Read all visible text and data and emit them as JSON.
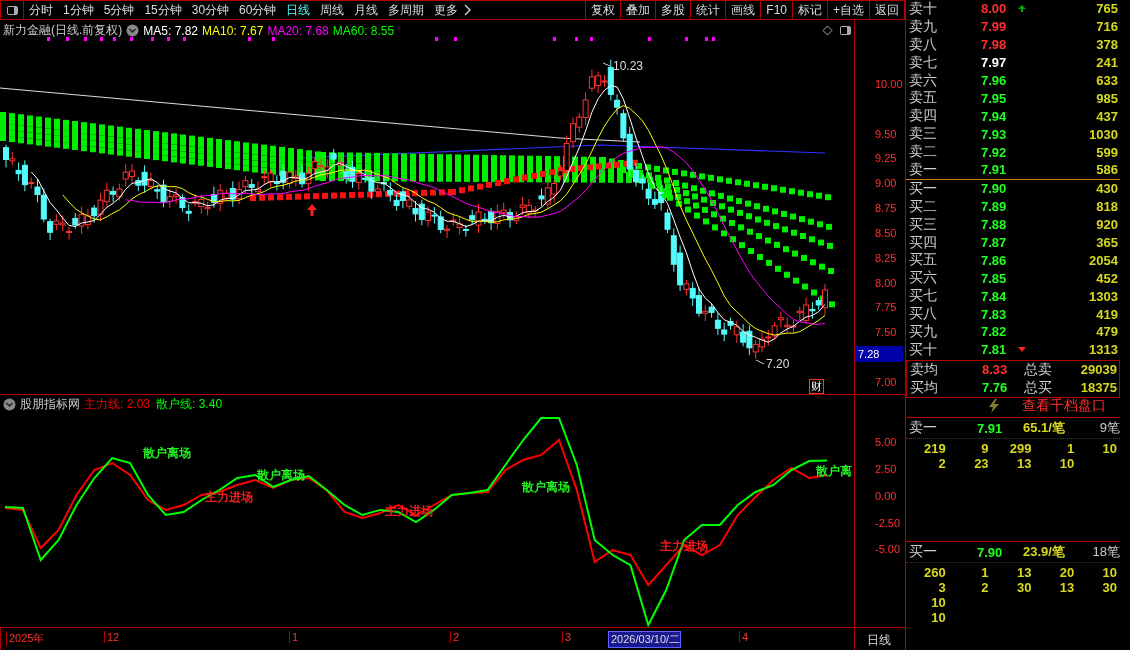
{
  "toolbar": {
    "periods": [
      {
        "label": "分时",
        "selected": false
      },
      {
        "label": "1分钟",
        "selected": false
      },
      {
        "label": "5分钟",
        "selected": false
      },
      {
        "label": "15分钟",
        "selected": false
      },
      {
        "label": "30分钟",
        "selected": false
      },
      {
        "label": "60分钟",
        "selected": false
      },
      {
        "label": "日线",
        "selected": true
      },
      {
        "label": "周线",
        "selected": false
      },
      {
        "label": "月线",
        "selected": false
      },
      {
        "label": "多周期",
        "selected": false
      },
      {
        "label": "更多",
        "selected": false
      }
    ],
    "actions": [
      "复权",
      "叠加",
      "多股",
      "统计",
      "画线",
      "F10",
      "标记",
      "+自选",
      "返回"
    ]
  },
  "main_chart": {
    "title": "新力金融(日线.前复权)",
    "ma": [
      {
        "label": "MA5: 7.82",
        "color": "#ffffff"
      },
      {
        "label": "MA10: 7.67",
        "color": "#ffff00"
      },
      {
        "label": "MA20: 7.68",
        "color": "#ff00ff"
      },
      {
        "label": "MA60: 8.55",
        "color": "#00ff00"
      }
    ],
    "yticks": [
      "10.00",
      "9.50",
      "9.25",
      "9.00",
      "8.75",
      "8.50",
      "8.25",
      "8.00",
      "7.75",
      "7.50",
      "7.00"
    ],
    "high_label": "10.23",
    "low_label": "7.20",
    "current_price": "7.28",
    "badge": "财"
  },
  "indicator": {
    "title": "股朋指标网",
    "lines": [
      {
        "name": "主力线",
        "value": ": 2.03",
        "color": "#ff0000"
      },
      {
        "name": "散户线",
        "value": ": 3.40",
        "color": "#00ff00"
      }
    ],
    "yticks": [
      "5.00",
      "2.50",
      "0.00",
      "-2.50",
      "-5.00"
    ],
    "signals": [
      {
        "text": "散户离场",
        "color": "#20ff20"
      },
      {
        "text": "主力进场",
        "color": "#ff2020"
      },
      {
        "text": "散户离场",
        "color": "#20ff20"
      },
      {
        "text": "主力进场",
        "color": "#ff2020"
      },
      {
        "text": "散户离场",
        "color": "#20ff20"
      },
      {
        "text": "主力进场",
        "color": "#ff2020"
      },
      {
        "text": "散户离",
        "color": "#20ff20"
      }
    ],
    "kind": "picture"
  },
  "order_book": {
    "rows": [
      {
        "label": "卖十",
        "price": "8.00",
        "volume": "765",
        "color": "#ff3030",
        "kind": "rising"
      },
      {
        "label": "卖九",
        "price": "7.99",
        "volume": "716",
        "color": "#ff3030"
      },
      {
        "label": "卖八",
        "price": "7.98",
        "volume": "378",
        "color": "#ff3030"
      },
      {
        "label": "卖七",
        "price": "7.97",
        "volume": "241",
        "color": "#ffffff"
      },
      {
        "label": "卖六",
        "price": "7.96",
        "volume": "633",
        "color": "#20ff20"
      },
      {
        "label": "卖五",
        "price": "7.95",
        "volume": "985",
        "color": "#20ff20"
      },
      {
        "label": "卖四",
        "price": "7.94",
        "volume": "437",
        "color": "#20ff20"
      },
      {
        "label": "卖三",
        "price": "7.93",
        "volume": "1030",
        "color": "#20ff20"
      },
      {
        "label": "卖二",
        "price": "7.92",
        "volume": "599",
        "color": "#20ff20"
      },
      {
        "label": "卖一",
        "price": "7.91",
        "volume": "586",
        "color": "#20ff20"
      },
      {
        "label": "买一",
        "price": "7.90",
        "volume": "430",
        "color": "#20ff20"
      },
      {
        "label": "买二",
        "price": "7.89",
        "volume": "818",
        "color": "#20ff20"
      },
      {
        "label": "买三",
        "price": "7.88",
        "volume": "920",
        "color": "#20ff20"
      },
      {
        "label": "买四",
        "price": "7.87",
        "volume": "365",
        "color": "#20ff20"
      },
      {
        "label": "买五",
        "price": "7.86",
        "volume": "2054",
        "color": "#20ff20"
      },
      {
        "label": "买六",
        "price": "7.85",
        "volume": "452",
        "color": "#20ff20"
      },
      {
        "label": "买七",
        "price": "7.84",
        "volume": "1303",
        "color": "#20ff20"
      },
      {
        "label": "买八",
        "price": "7.83",
        "volume": "419",
        "color": "#20ff20"
      },
      {
        "label": "买九",
        "price": "7.82",
        "volume": "479",
        "color": "#20ff20"
      },
      {
        "label": "买十",
        "price": "7.81",
        "volume": "1313",
        "color": "#20ff20",
        "kind": "falling"
      }
    ],
    "averages": [
      {
        "label": "卖均",
        "price": "8.33",
        "color": "#ff3030",
        "total_label": "总卖",
        "total": "29039"
      },
      {
        "label": "买均",
        "price": "7.76",
        "color": "#20ff20",
        "total_label": "总买",
        "total": "18375"
      }
    ]
  },
  "queue_panel": {
    "button": "查看千档盘口",
    "queues": [
      {
        "label": "卖一",
        "price": "7.91",
        "average": "65.1/笔",
        "count": "9笔",
        "rows": [
          [
            "219",
            "9",
            "299",
            "1",
            "10"
          ],
          [
            "2",
            "23",
            "13",
            "10"
          ]
        ]
      },
      {
        "label": "买一",
        "price": "7.90",
        "average": "23.9/笔",
        "count": "18笔",
        "rows": [
          [
            "260",
            "1",
            "13",
            "20",
            "10"
          ],
          [
            "3",
            "2",
            "30",
            "13",
            "30"
          ],
          [
            "10"
          ],
          [
            "10"
          ]
        ]
      }
    ]
  },
  "time_axis": {
    "labels": [
      {
        "text": "2025年",
        "selected": false
      },
      {
        "text": "12",
        "selected": false
      },
      {
        "text": "1",
        "selected": false
      },
      {
        "text": "2",
        "selected": false
      },
      {
        "text": "3",
        "selected": false
      },
      {
        "text": "2026/03/10/二",
        "selected": true
      },
      {
        "text": "4",
        "selected": false
      }
    ],
    "period": "日线"
  }
}
